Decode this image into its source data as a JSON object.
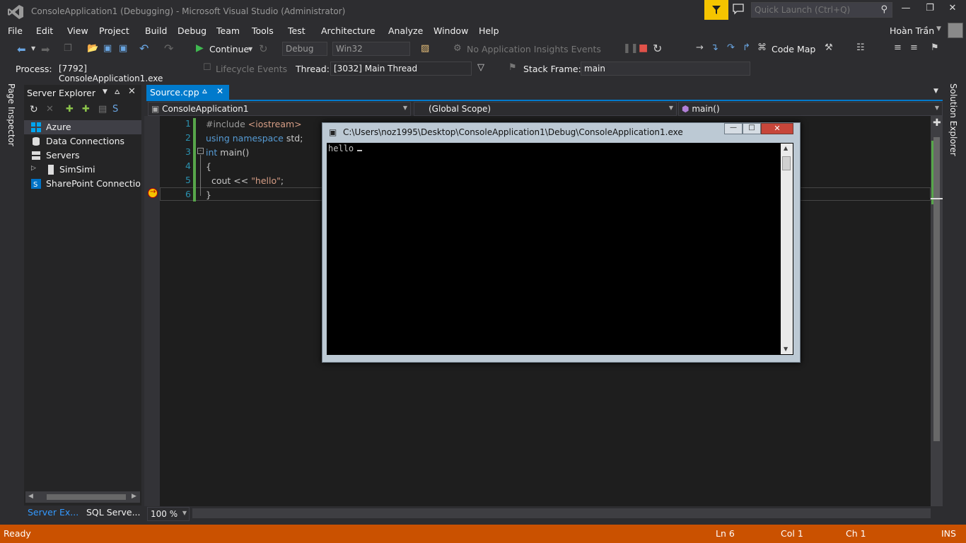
{
  "titlebar": {
    "title": "ConsoleApplication1 (Debugging) - Microsoft Visual Studio (Administrator)",
    "quick_launch_placeholder": "Quick Launch (Ctrl+Q)"
  },
  "menu": [
    "File",
    "Edit",
    "View",
    "Project",
    "Build",
    "Debug",
    "Team",
    "Tools",
    "Test",
    "Architecture",
    "Analyze",
    "Window",
    "Help"
  ],
  "user_name": "Hoàn Trần",
  "toolbar": {
    "continue_label": "Continue",
    "config_value": "Debug",
    "platform_value": "Win32",
    "insights_label": "No Application Insights Events",
    "code_map_label": "Code Map"
  },
  "debug_bar": {
    "process_label": "Process:",
    "process_value": "[7792] ConsoleApplication1.exe",
    "lifecycle_label": "Lifecycle Events",
    "thread_label": "Thread:",
    "thread_value": "[3032] Main Thread",
    "stack_frame_label": "Stack Frame:",
    "stack_frame_value": "main"
  },
  "left_strip": {
    "page_inspector": "Page Inspector"
  },
  "right_strip": {
    "solution_explorer": "Solution Explorer"
  },
  "server_explorer": {
    "title": "Server Explorer",
    "items": [
      {
        "label": "Azure",
        "icon": "azure-icon"
      },
      {
        "label": "Data Connections",
        "icon": "database-icon"
      },
      {
        "label": "Servers",
        "icon": "server-icon"
      },
      {
        "label": "SimSimi",
        "icon": "computer-icon"
      },
      {
        "label": "SharePoint Connections",
        "icon": "sharepoint-icon"
      }
    ],
    "bottom_tabs": [
      "Server Ex...",
      "SQL Serve..."
    ]
  },
  "editor": {
    "tab_label": "Source.cpp",
    "project_dropdown": "ConsoleApplication1",
    "scope_dropdown": "(Global Scope)",
    "member_dropdown": "main()",
    "line_numbers": [
      "1",
      "2",
      "3",
      "4",
      "5",
      "6"
    ],
    "zoom": "100 %"
  },
  "console": {
    "title": "C:\\Users\\noz1995\\Desktop\\ConsoleApplication1\\Debug\\ConsoleApplication1.exe",
    "output": "hello"
  },
  "status": {
    "state": "Ready",
    "ln": "Ln 6",
    "col": "Col 1",
    "ch": "Ch 1",
    "mode": "INS"
  },
  "colors": {
    "status_bar": "#ca5100",
    "accent": "#007acc",
    "notification": "#f5c400"
  }
}
